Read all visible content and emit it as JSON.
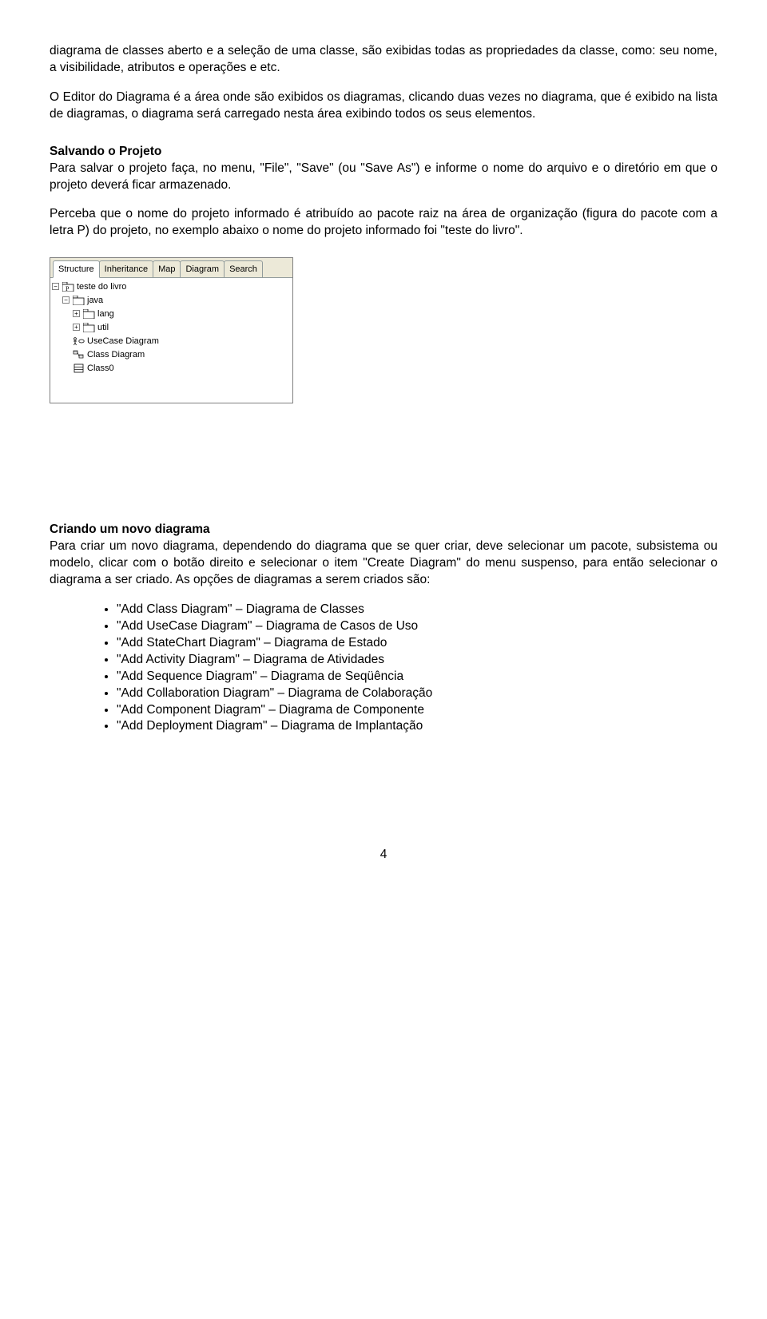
{
  "para_intro": "diagrama de classes aberto e a seleção de uma classe, são exibidas todas as propriedades da classe, como: seu nome, a visibilidade, atributos e operações e etc.",
  "para_editor": "O Editor do Diagrama é a área onde são exibidos os diagramas, clicando duas vezes no diagrama, que é exibido na lista de diagramas, o diagrama será carregado nesta área exibindo todos os seus elementos.",
  "save_title": "Salvando o Projeto",
  "save_body1": "Para salvar o projeto faça, no menu, \"File\", \"Save\" (ou \"Save As\") e informe o nome do arquivo e o diretório em que o projeto deverá ficar armazenado.",
  "save_body2": "Perceba que o nome do projeto informado é atribuído ao pacote raiz na área de organização (figura do pacote com a letra P) do projeto, no exemplo abaixo o nome do projeto informado foi \"teste do livro\".",
  "ui": {
    "tabs": [
      "Structure",
      "Inheritance",
      "Map",
      "Diagram",
      "Search"
    ],
    "nodes": {
      "root": "teste do livro",
      "pkg1": "java",
      "leaf1": "lang",
      "leaf2": "util",
      "uc": "UseCase Diagram",
      "cd": "Class Diagram",
      "cls": "Class0"
    }
  },
  "create_title": "Criando um novo diagrama",
  "create_body": "Para criar um novo diagrama, dependendo do diagrama que se quer criar, deve selecionar um pacote, subsistema ou modelo, clicar com o botão direito e selecionar o item \"Create Diagram\" do menu suspenso, para então selecionar o diagrama a ser criado. As opções de diagramas a serem criados são:",
  "diagram_options": [
    "\"Add Class Diagram\" – Diagrama de Classes",
    "\"Add UseCase Diagram\" – Diagrama de Casos de Uso",
    "\"Add StateChart Diagram\" – Diagrama de Estado",
    "\"Add Activity Diagram\" – Diagrama de Atividades",
    "\"Add Sequence Diagram\" – Diagrama de Seqüência",
    "\"Add Collaboration Diagram\" – Diagrama de Colaboração",
    "\"Add Component Diagram\" – Diagrama de Componente",
    "\"Add Deployment Diagram\" – Diagrama de Implantação"
  ],
  "page_num": "4"
}
